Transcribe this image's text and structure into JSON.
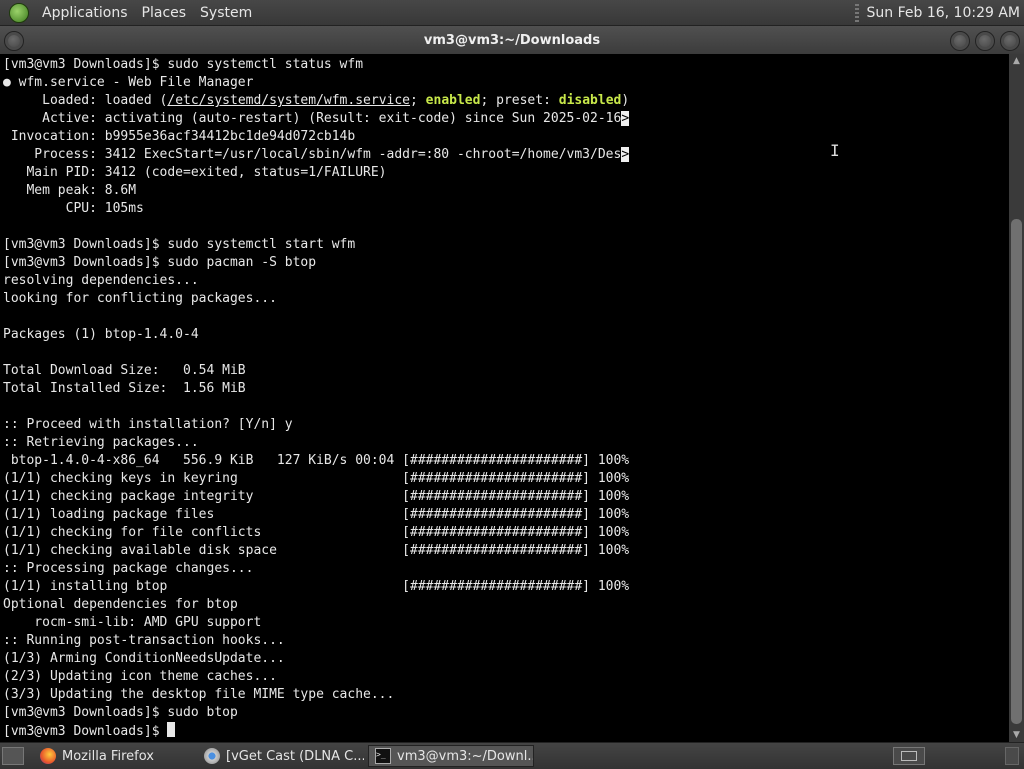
{
  "top_panel": {
    "menus": [
      "Applications",
      "Places",
      "System"
    ],
    "clock": "Sun Feb 16, 10:29 AM"
  },
  "window": {
    "title": "vm3@vm3:~/Downloads"
  },
  "terminal": {
    "lines": [
      "[vm3@vm3 Downloads]$ sudo systemctl status wfm",
      "● wfm.service - Web File Manager",
      "     Loaded: loaded (/etc/systemd/system/wfm.service; enabled; preset: disabled)",
      "     Active: activating (auto-restart) (Result: exit-code) since Sun 2025-02-16",
      " Invocation: b9955e36acf34412bc1de94d072cb14b",
      "    Process: 3412 ExecStart=/usr/local/sbin/wfm -addr=:80 -chroot=/home/vm3/Des",
      "   Main PID: 3412 (code=exited, status=1/FAILURE)",
      "   Mem peak: 8.6M",
      "        CPU: 105ms",
      "",
      "[vm3@vm3 Downloads]$ sudo systemctl start wfm",
      "[vm3@vm3 Downloads]$ sudo pacman -S btop",
      "resolving dependencies...",
      "looking for conflicting packages...",
      "",
      "Packages (1) btop-1.4.0-4",
      "",
      "Total Download Size:   0.54 MiB",
      "Total Installed Size:  1.56 MiB",
      "",
      ":: Proceed with installation? [Y/n] y",
      ":: Retrieving packages...",
      " btop-1.4.0-4-x86_64   556.9 KiB   127 KiB/s 00:04 [######################] 100%",
      "(1/1) checking keys in keyring                     [######################] 100%",
      "(1/1) checking package integrity                   [######################] 100%",
      "(1/1) loading package files                        [######################] 100%",
      "(1/1) checking for file conflicts                  [######################] 100%",
      "(1/1) checking available disk space                [######################] 100%",
      ":: Processing package changes...",
      "(1/1) installing btop                              [######################] 100%",
      "Optional dependencies for btop",
      "    rocm-smi-lib: AMD GPU support",
      ":: Running post-transaction hooks...",
      "(1/3) Arming ConditionNeedsUpdate...",
      "(2/3) Updating icon theme caches...",
      "(3/3) Updating the desktop file MIME type cache...",
      "[vm3@vm3 Downloads]$ sudo btop",
      "[vm3@vm3 Downloads]$ "
    ],
    "truncated_lines": [
      3,
      5
    ],
    "truncation_marker": ">",
    "highlight_words": [
      "enabled",
      "disabled"
    ],
    "underline_text": "/etc/systemd/system/wfm.service",
    "prompt_line": 37
  },
  "taskbar": {
    "tasks": [
      {
        "label": "Mozilla Firefox",
        "icon": "firefox-icon",
        "active": false
      },
      {
        "label": "[vGet Cast (DLNA C...",
        "icon": "chrome-icon",
        "active": false
      },
      {
        "label": "vm3@vm3:~/Downl...",
        "icon": "terminal-icon",
        "active": true
      }
    ]
  },
  "colors": {
    "terminal_bg": "#000000",
    "terminal_fg": "#e8e8e8",
    "highlight": "#c8e84a"
  }
}
